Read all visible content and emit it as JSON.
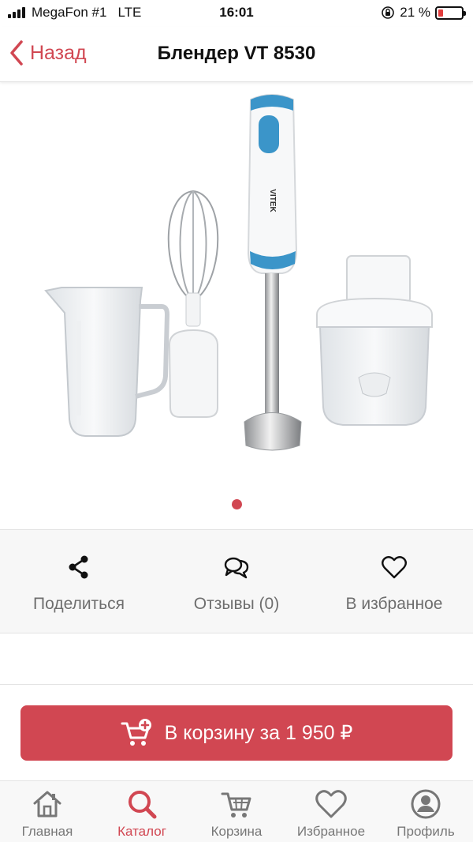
{
  "status_bar": {
    "carrier": "MegaFon #1",
    "network": "LTE",
    "time": "16:01",
    "battery_text": "21 %",
    "battery_level": 0.21
  },
  "navbar": {
    "back_label": "Назад",
    "title": "Блендер VT 8530"
  },
  "product": {
    "brand_on_device": "VITEK",
    "gallery_pages": 1,
    "gallery_current": 1
  },
  "actions": [
    {
      "label": "Поделиться",
      "icon": "share-icon"
    },
    {
      "label": "Отзывы (0)",
      "icon": "chat-bubbles-icon"
    },
    {
      "label": "В избранное",
      "icon": "heart-icon"
    }
  ],
  "cart_button": {
    "label": "В корзину за 1 950 ₽",
    "icon": "cart-add-icon"
  },
  "tabbar": [
    {
      "label": "Главная",
      "icon": "home-icon",
      "active": false
    },
    {
      "label": "Каталог",
      "icon": "search-icon",
      "active": true
    },
    {
      "label": "Корзина",
      "icon": "cart-icon",
      "active": false
    },
    {
      "label": "Избранное",
      "icon": "heart-icon",
      "active": false
    },
    {
      "label": "Профиль",
      "icon": "profile-icon",
      "active": false
    }
  ],
  "colors": {
    "accent": "#d14752",
    "blender_blue": "#3b95c9",
    "inactive_gray": "#777777"
  }
}
